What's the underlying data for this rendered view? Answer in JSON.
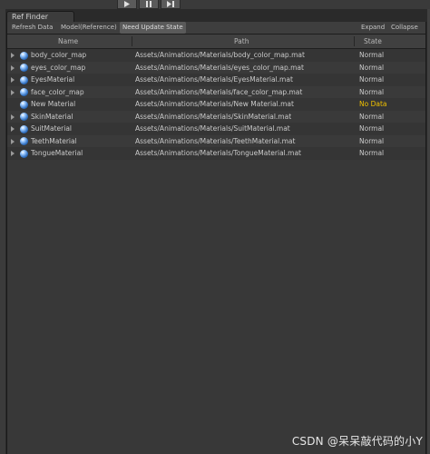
{
  "window": {
    "tab_title": "Ref Finder"
  },
  "toolbar": {
    "refresh": "Refresh Data",
    "model": "Model(Reference)",
    "need_update": "Need Update State",
    "expand": "Expand",
    "collapse": "Collapse"
  },
  "columns": {
    "name": "Name",
    "path": "Path",
    "state": "State"
  },
  "rows": [
    {
      "name": "body_color_map",
      "path": "Assets/Animations/Materials/body_color_map.mat",
      "state": "Normal",
      "expandable": true
    },
    {
      "name": "eyes_color_map",
      "path": "Assets/Animations/Materials/eyes_color_map.mat",
      "state": "Normal",
      "expandable": true
    },
    {
      "name": "EyesMaterial",
      "path": "Assets/Animations/Materials/EyesMaterial.mat",
      "state": "Normal",
      "expandable": true
    },
    {
      "name": "face_color_map",
      "path": "Assets/Animations/Materials/face_color_map.mat",
      "state": "Normal",
      "expandable": true
    },
    {
      "name": "New Material",
      "path": "Assets/Animations/Materials/New Material.mat",
      "state": "No Data",
      "expandable": false
    },
    {
      "name": "SkinMaterial",
      "path": "Assets/Animations/Materials/SkinMaterial.mat",
      "state": "Normal",
      "expandable": true
    },
    {
      "name": "SuitMaterial",
      "path": "Assets/Animations/Materials/SuitMaterial.mat",
      "state": "Normal",
      "expandable": true
    },
    {
      "name": "TeethMaterial",
      "path": "Assets/Animations/Materials/TeethMaterial.mat",
      "state": "Normal",
      "expandable": true
    },
    {
      "name": "TongueMaterial",
      "path": "Assets/Animations/Materials/TongueMaterial.mat",
      "state": "Normal",
      "expandable": true
    }
  ],
  "row_icon": "material-sphere-icon",
  "watermark": "CSDN @呆呆敲代码的小Y",
  "colors": {
    "no_data": "#f0c000",
    "normal": "#cacaca"
  }
}
